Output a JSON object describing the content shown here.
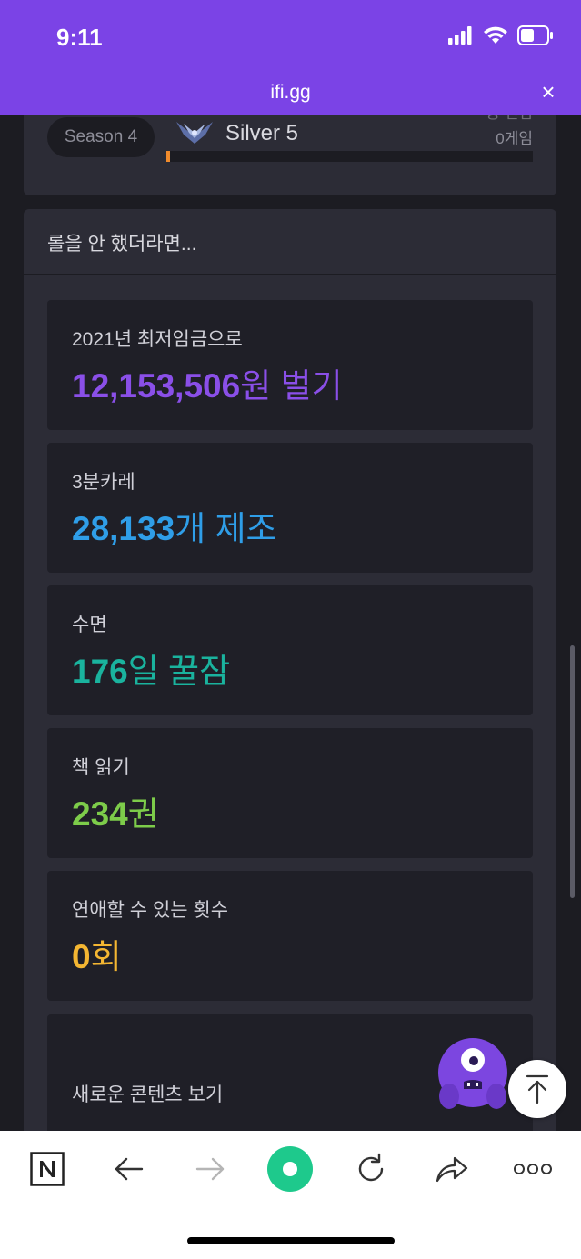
{
  "status_bar": {
    "time": "9:11"
  },
  "header": {
    "url": "ifi.gg",
    "close_label": "×",
    "color": "#7b43e6"
  },
  "season_panel": {
    "season_label": "Season 4",
    "tier_name": "Silver 5",
    "rank_text_partial": "승 전임",
    "games_text": "0게임",
    "progress_fraction": 0.01
  },
  "main_panel": {
    "title": "롤을 안 했더라면...",
    "cards": [
      {
        "label": "2021년 최저임금으로",
        "value_num": "12,153,506",
        "value_unit": "원 벌기",
        "color": "#8a4fe8"
      },
      {
        "label": "3분카레",
        "value_num": "28,133",
        "value_unit": "개 제조",
        "color": "#2f9ee8"
      },
      {
        "label": "수면",
        "value_num": "176",
        "value_unit": "일 꿀잠",
        "color": "#1ab39e"
      },
      {
        "label": "책 읽기",
        "value_num": "234",
        "value_unit": "권",
        "color": "#7dcc4a"
      },
      {
        "label": "연애할 수 있는 횟수",
        "value_num": "0",
        "value_unit": "회",
        "color": "#f4b632"
      }
    ],
    "more_label": "새로운 콘텐츠 보기"
  },
  "floating": {
    "mascot_icon": "purple-one-eyed-monster-icon",
    "top_button_icon": "arrow-up-to-top-icon"
  },
  "bottom_nav": {
    "items": [
      "naver-n-icon",
      "back-arrow-icon",
      "forward-arrow-icon",
      "green-home-circle-icon",
      "refresh-icon",
      "share-icon",
      "more-dots-icon"
    ],
    "home_color": "#1ec98c"
  }
}
